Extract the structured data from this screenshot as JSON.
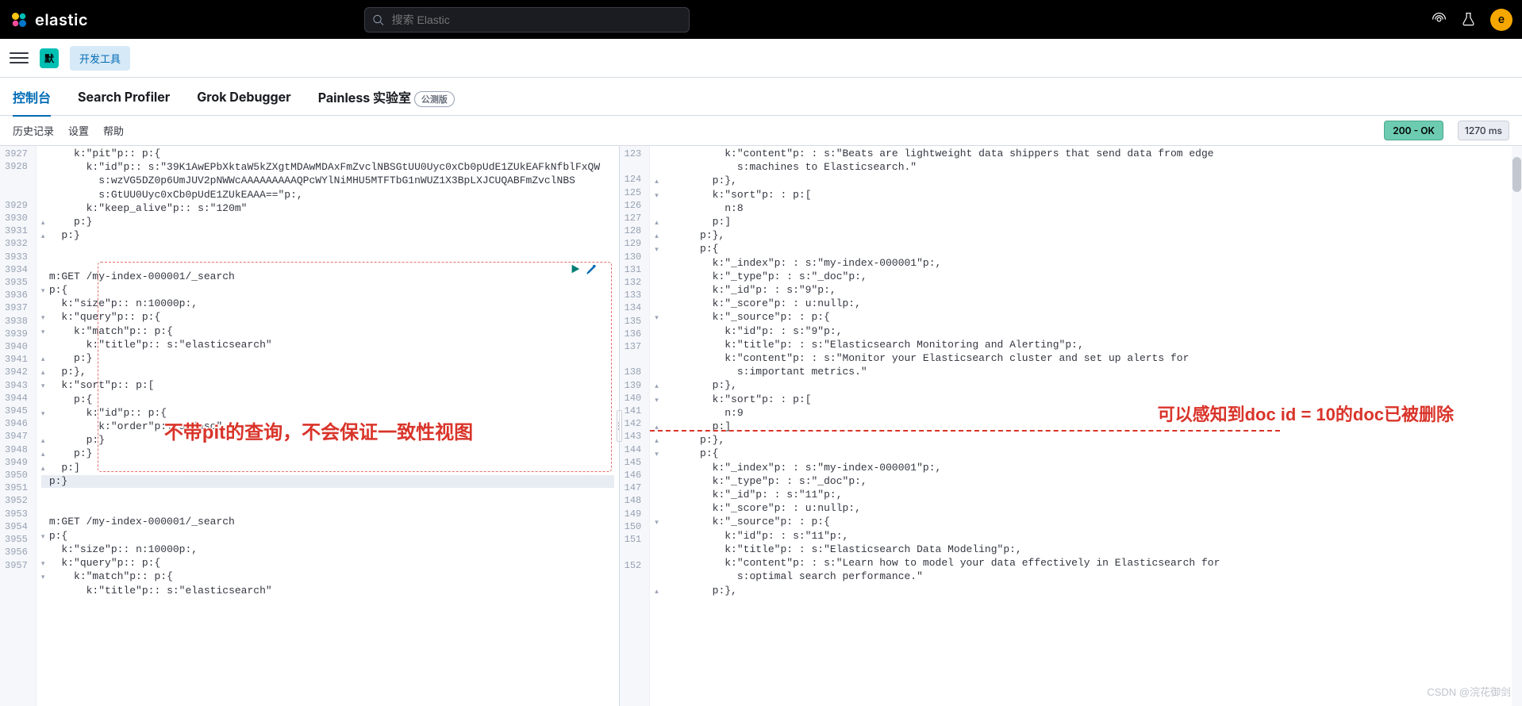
{
  "header": {
    "brand": "elastic",
    "search_placeholder": "搜索 Elastic",
    "avatar_initial": "e"
  },
  "subheader": {
    "space_badge": "默",
    "app_name": "开发工具"
  },
  "tabs": [
    {
      "label": "控制台",
      "active": true
    },
    {
      "label": "Search Profiler"
    },
    {
      "label": "Grok Debugger"
    },
    {
      "label": "Painless 实验室",
      "beta": "公测版"
    }
  ],
  "toolbar": {
    "items": [
      "历史记录",
      "设置",
      "帮助"
    ],
    "status": "200 - OK",
    "time": "1270 ms"
  },
  "annotations": {
    "left": "不带pit的查询，不会保证一致性视图",
    "right": "可以感知到doc id = 10的doc已被删除"
  },
  "watermark": "CSDN @浣花御剑",
  "left_editor": {
    "first_line": 3927,
    "lines": [
      {
        "n": "3927",
        "t": [
          "    ",
          "k:\"pit\"",
          "p:: ",
          "p:{"
        ],
        "f": ""
      },
      {
        "n": "3928",
        "t": [
          "      ",
          "k:\"id\"",
          "p:: ",
          "s:\"39K1AwEPbXktaW5kZXgtMDAwMDAxFmZvclNBSGtUU0Uyc0xCb0pUdE1ZUkEAFkNfblFxQW"
        ],
        "f": ""
      },
      {
        "n": "",
        "t": [
          "        ",
          "s:wzVG5DZ0p6UmJUV2pNWWcAAAAAAAAAQPcWYlNiMHU5MTFTbG1nWUZ1X3BpLXJCUQABFmZvclNBS"
        ],
        "f": ""
      },
      {
        "n": "",
        "t": [
          "        ",
          "s:GtUU0Uyc0xCb0pUdE1ZUkEAAA==\"",
          "p:,"
        ],
        "f": ""
      },
      {
        "n": "3929",
        "t": [
          "      ",
          "k:\"keep_alive\"",
          "p:: ",
          "s:\"120m\""
        ],
        "f": ""
      },
      {
        "n": "3930",
        "t": [
          "    ",
          "p:}"
        ],
        "f": "▴"
      },
      {
        "n": "3931",
        "t": [
          "  ",
          "p:}"
        ],
        "f": "▴"
      },
      {
        "n": "3932",
        "t": [],
        "f": ""
      },
      {
        "n": "3933",
        "t": [],
        "f": ""
      },
      {
        "n": "3934",
        "t": [
          "m:GET",
          " /my-index-000001/_search"
        ],
        "f": ""
      },
      {
        "n": "3935",
        "t": [
          "p:{"
        ],
        "f": "▾"
      },
      {
        "n": "3936",
        "t": [
          "  ",
          "k:\"size\"",
          "p:: ",
          "n:10000",
          "p:,"
        ],
        "f": ""
      },
      {
        "n": "3937",
        "t": [
          "  ",
          "k:\"query\"",
          "p:: ",
          "p:{"
        ],
        "f": "▾"
      },
      {
        "n": "3938",
        "t": [
          "    ",
          "k:\"match\"",
          "p:: ",
          "p:{"
        ],
        "f": "▾"
      },
      {
        "n": "3939",
        "t": [
          "      ",
          "k:\"title\"",
          "p:: ",
          "s:\"elasticsearch\""
        ],
        "f": ""
      },
      {
        "n": "3940",
        "t": [
          "    ",
          "p:}"
        ],
        "f": "▴"
      },
      {
        "n": "3941",
        "t": [
          "  ",
          "p:},"
        ],
        "f": "▴"
      },
      {
        "n": "3942",
        "t": [
          "  ",
          "k:\"sort\"",
          "p:: ",
          "p:["
        ],
        "f": "▾"
      },
      {
        "n": "3943",
        "t": [
          "    ",
          "p:{"
        ],
        "f": ""
      },
      {
        "n": "3944",
        "t": [
          "      ",
          "k:\"id\"",
          "p:: ",
          "p:{"
        ],
        "f": "▾"
      },
      {
        "n": "3945",
        "t": [
          "        ",
          "k:\"order\"",
          "p:: ",
          "s:\"asc\""
        ],
        "f": ""
      },
      {
        "n": "3946",
        "t": [
          "      ",
          "p:}"
        ],
        "f": "▴"
      },
      {
        "n": "3947",
        "t": [
          "    ",
          "p:}"
        ],
        "f": "▴"
      },
      {
        "n": "3948",
        "t": [
          "  ",
          "p:]"
        ],
        "f": "▴"
      },
      {
        "n": "3949",
        "t": [
          "p:}"
        ],
        "f": "",
        "hl": true
      },
      {
        "n": "3950",
        "t": [],
        "f": ""
      },
      {
        "n": "3951",
        "t": [],
        "f": ""
      },
      {
        "n": "3952",
        "t": [
          "m:GET",
          " /my-index-000001/_search"
        ],
        "f": ""
      },
      {
        "n": "3953",
        "t": [
          "p:{"
        ],
        "f": "▾"
      },
      {
        "n": "3954",
        "t": [
          "  ",
          "k:\"size\"",
          "p:: ",
          "n:10000",
          "p:,"
        ],
        "f": ""
      },
      {
        "n": "3955",
        "t": [
          "  ",
          "k:\"query\"",
          "p:: ",
          "p:{"
        ],
        "f": "▾"
      },
      {
        "n": "3956",
        "t": [
          "    ",
          "k:\"match\"",
          "p:: ",
          "p:{"
        ],
        "f": "▾"
      },
      {
        "n": "3957",
        "t": [
          "      ",
          "k:\"title\"",
          "p:: ",
          "s:\"elasticsearch\""
        ],
        "f": ""
      }
    ]
  },
  "right_editor": {
    "lines": [
      {
        "n": "123",
        "t": [
          "          ",
          "k:\"content\"",
          "p: : ",
          "s:\"Beats are lightweight data shippers that send data from edge"
        ],
        "f": ""
      },
      {
        "n": "",
        "t": [
          "            ",
          "s:machines to Elasticsearch.\""
        ],
        "f": ""
      },
      {
        "n": "124",
        "t": [
          "        ",
          "p:},"
        ],
        "f": "▴"
      },
      {
        "n": "125",
        "t": [
          "        ",
          "k:\"sort\"",
          "p: : ",
          "p:["
        ],
        "f": "▾"
      },
      {
        "n": "126",
        "t": [
          "          ",
          "n:8"
        ],
        "f": ""
      },
      {
        "n": "127",
        "t": [
          "        ",
          "p:]"
        ],
        "f": "▴"
      },
      {
        "n": "128",
        "t": [
          "      ",
          "p:},"
        ],
        "f": "▴"
      },
      {
        "n": "129",
        "t": [
          "      ",
          "p:{"
        ],
        "f": "▾"
      },
      {
        "n": "130",
        "t": [
          "        ",
          "k:\"_index\"",
          "p: : ",
          "s:\"my-index-000001\"",
          "p:,"
        ],
        "f": ""
      },
      {
        "n": "131",
        "t": [
          "        ",
          "k:\"_type\"",
          "p: : ",
          "s:\"_doc\"",
          "p:,"
        ],
        "f": ""
      },
      {
        "n": "132",
        "t": [
          "        ",
          "k:\"_id\"",
          "p: : ",
          "s:\"9\"",
          "p:,"
        ],
        "f": ""
      },
      {
        "n": "133",
        "t": [
          "        ",
          "k:\"_score\"",
          "p: : ",
          "u:null",
          "p:,"
        ],
        "f": ""
      },
      {
        "n": "134",
        "t": [
          "        ",
          "k:\"_source\"",
          "p: : ",
          "p:{"
        ],
        "f": "▾"
      },
      {
        "n": "135",
        "t": [
          "          ",
          "k:\"id\"",
          "p: : ",
          "s:\"9\"",
          "p:,"
        ],
        "f": ""
      },
      {
        "n": "136",
        "t": [
          "          ",
          "k:\"title\"",
          "p: : ",
          "s:\"Elasticsearch Monitoring and Alerting\"",
          "p:,"
        ],
        "f": ""
      },
      {
        "n": "137",
        "t": [
          "          ",
          "k:\"content\"",
          "p: : ",
          "s:\"Monitor your Elasticsearch cluster and set up alerts for"
        ],
        "f": ""
      },
      {
        "n": "",
        "t": [
          "            ",
          "s:important metrics.\""
        ],
        "f": ""
      },
      {
        "n": "138",
        "t": [
          "        ",
          "p:},"
        ],
        "f": "▴"
      },
      {
        "n": "139",
        "t": [
          "        ",
          "k:\"sort\"",
          "p: : ",
          "p:["
        ],
        "f": "▾"
      },
      {
        "n": "140",
        "t": [
          "          ",
          "n:9"
        ],
        "f": ""
      },
      {
        "n": "141",
        "t": [
          "        ",
          "p:]"
        ],
        "f": "▴"
      },
      {
        "n": "142",
        "t": [
          "      ",
          "p:},"
        ],
        "f": "▴"
      },
      {
        "n": "143",
        "t": [
          "      ",
          "p:{"
        ],
        "f": "▾"
      },
      {
        "n": "144",
        "t": [
          "        ",
          "k:\"_index\"",
          "p: : ",
          "s:\"my-index-000001\"",
          "p:,"
        ],
        "f": ""
      },
      {
        "n": "145",
        "t": [
          "        ",
          "k:\"_type\"",
          "p: : ",
          "s:\"_doc\"",
          "p:,"
        ],
        "f": ""
      },
      {
        "n": "146",
        "t": [
          "        ",
          "k:\"_id\"",
          "p: : ",
          "s:\"11\"",
          "p:,"
        ],
        "f": ""
      },
      {
        "n": "147",
        "t": [
          "        ",
          "k:\"_score\"",
          "p: : ",
          "u:null",
          "p:,"
        ],
        "f": ""
      },
      {
        "n": "148",
        "t": [
          "        ",
          "k:\"_source\"",
          "p: : ",
          "p:{"
        ],
        "f": "▾"
      },
      {
        "n": "149",
        "t": [
          "          ",
          "k:\"id\"",
          "p: : ",
          "s:\"11\"",
          "p:,"
        ],
        "f": ""
      },
      {
        "n": "150",
        "t": [
          "          ",
          "k:\"title\"",
          "p: : ",
          "s:\"Elasticsearch Data Modeling\"",
          "p:,"
        ],
        "f": ""
      },
      {
        "n": "151",
        "t": [
          "          ",
          "k:\"content\"",
          "p: : ",
          "s:\"Learn how to model your data effectively in Elasticsearch for"
        ],
        "f": ""
      },
      {
        "n": "",
        "t": [
          "            ",
          "s:optimal search performance.\""
        ],
        "f": ""
      },
      {
        "n": "152",
        "t": [
          "        ",
          "p:},"
        ],
        "f": "▴"
      }
    ]
  }
}
